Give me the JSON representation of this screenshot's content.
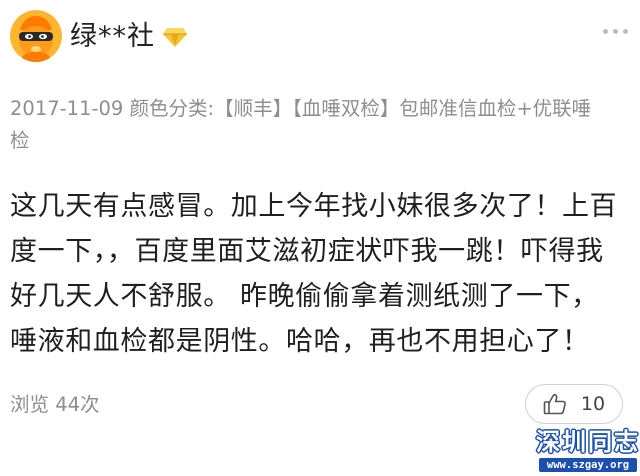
{
  "header": {
    "username": "绿**社",
    "avatar_icon": "masked-orange-character-avatar",
    "badge_icon": "gold-diamond-icon",
    "more_icon": "more-dots-icon"
  },
  "review": {
    "meta": "2017-11-09 颜色分类:【顺丰】【血唾双检】包邮准信血检+优联唾检",
    "content": "这几天有点感冒。加上今年找小妹很多次了！上百度一下，，百度里面艾滋初症状吓我一跳！吓得我好几天人不舒服。 昨晚偷偷拿着测纸测了一下，唾液和血检都是阴性。哈哈，再也不用担心了！",
    "views": "浏览 44次",
    "like_count": "10",
    "like_icon": "thumbs-up-icon"
  },
  "watermark": {
    "title": "深圳同志",
    "url": "www.szgay.org"
  },
  "colors": {
    "muted_text": "#8e8e8e",
    "avatar_orange": "#ff8a00",
    "watermark_blue": "#1d4fae"
  }
}
